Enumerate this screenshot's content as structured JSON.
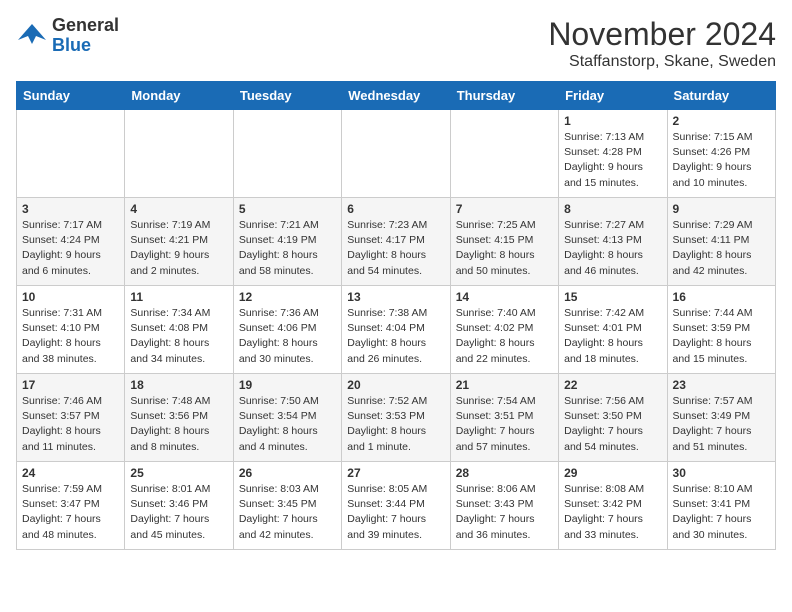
{
  "header": {
    "logo_line1": "General",
    "logo_line2": "Blue",
    "month": "November 2024",
    "location": "Staffanstorp, Skane, Sweden"
  },
  "days_of_week": [
    "Sunday",
    "Monday",
    "Tuesday",
    "Wednesday",
    "Thursday",
    "Friday",
    "Saturday"
  ],
  "weeks": [
    [
      {
        "day": "",
        "info": ""
      },
      {
        "day": "",
        "info": ""
      },
      {
        "day": "",
        "info": ""
      },
      {
        "day": "",
        "info": ""
      },
      {
        "day": "",
        "info": ""
      },
      {
        "day": "1",
        "info": "Sunrise: 7:13 AM\nSunset: 4:28 PM\nDaylight: 9 hours\nand 15 minutes."
      },
      {
        "day": "2",
        "info": "Sunrise: 7:15 AM\nSunset: 4:26 PM\nDaylight: 9 hours\nand 10 minutes."
      }
    ],
    [
      {
        "day": "3",
        "info": "Sunrise: 7:17 AM\nSunset: 4:24 PM\nDaylight: 9 hours\nand 6 minutes."
      },
      {
        "day": "4",
        "info": "Sunrise: 7:19 AM\nSunset: 4:21 PM\nDaylight: 9 hours\nand 2 minutes."
      },
      {
        "day": "5",
        "info": "Sunrise: 7:21 AM\nSunset: 4:19 PM\nDaylight: 8 hours\nand 58 minutes."
      },
      {
        "day": "6",
        "info": "Sunrise: 7:23 AM\nSunset: 4:17 PM\nDaylight: 8 hours\nand 54 minutes."
      },
      {
        "day": "7",
        "info": "Sunrise: 7:25 AM\nSunset: 4:15 PM\nDaylight: 8 hours\nand 50 minutes."
      },
      {
        "day": "8",
        "info": "Sunrise: 7:27 AM\nSunset: 4:13 PM\nDaylight: 8 hours\nand 46 minutes."
      },
      {
        "day": "9",
        "info": "Sunrise: 7:29 AM\nSunset: 4:11 PM\nDaylight: 8 hours\nand 42 minutes."
      }
    ],
    [
      {
        "day": "10",
        "info": "Sunrise: 7:31 AM\nSunset: 4:10 PM\nDaylight: 8 hours\nand 38 minutes."
      },
      {
        "day": "11",
        "info": "Sunrise: 7:34 AM\nSunset: 4:08 PM\nDaylight: 8 hours\nand 34 minutes."
      },
      {
        "day": "12",
        "info": "Sunrise: 7:36 AM\nSunset: 4:06 PM\nDaylight: 8 hours\nand 30 minutes."
      },
      {
        "day": "13",
        "info": "Sunrise: 7:38 AM\nSunset: 4:04 PM\nDaylight: 8 hours\nand 26 minutes."
      },
      {
        "day": "14",
        "info": "Sunrise: 7:40 AM\nSunset: 4:02 PM\nDaylight: 8 hours\nand 22 minutes."
      },
      {
        "day": "15",
        "info": "Sunrise: 7:42 AM\nSunset: 4:01 PM\nDaylight: 8 hours\nand 18 minutes."
      },
      {
        "day": "16",
        "info": "Sunrise: 7:44 AM\nSunset: 3:59 PM\nDaylight: 8 hours\nand 15 minutes."
      }
    ],
    [
      {
        "day": "17",
        "info": "Sunrise: 7:46 AM\nSunset: 3:57 PM\nDaylight: 8 hours\nand 11 minutes."
      },
      {
        "day": "18",
        "info": "Sunrise: 7:48 AM\nSunset: 3:56 PM\nDaylight: 8 hours\nand 8 minutes."
      },
      {
        "day": "19",
        "info": "Sunrise: 7:50 AM\nSunset: 3:54 PM\nDaylight: 8 hours\nand 4 minutes."
      },
      {
        "day": "20",
        "info": "Sunrise: 7:52 AM\nSunset: 3:53 PM\nDaylight: 8 hours\nand 1 minute."
      },
      {
        "day": "21",
        "info": "Sunrise: 7:54 AM\nSunset: 3:51 PM\nDaylight: 7 hours\nand 57 minutes."
      },
      {
        "day": "22",
        "info": "Sunrise: 7:56 AM\nSunset: 3:50 PM\nDaylight: 7 hours\nand 54 minutes."
      },
      {
        "day": "23",
        "info": "Sunrise: 7:57 AM\nSunset: 3:49 PM\nDaylight: 7 hours\nand 51 minutes."
      }
    ],
    [
      {
        "day": "24",
        "info": "Sunrise: 7:59 AM\nSunset: 3:47 PM\nDaylight: 7 hours\nand 48 minutes."
      },
      {
        "day": "25",
        "info": "Sunrise: 8:01 AM\nSunset: 3:46 PM\nDaylight: 7 hours\nand 45 minutes."
      },
      {
        "day": "26",
        "info": "Sunrise: 8:03 AM\nSunset: 3:45 PM\nDaylight: 7 hours\nand 42 minutes."
      },
      {
        "day": "27",
        "info": "Sunrise: 8:05 AM\nSunset: 3:44 PM\nDaylight: 7 hours\nand 39 minutes."
      },
      {
        "day": "28",
        "info": "Sunrise: 8:06 AM\nSunset: 3:43 PM\nDaylight: 7 hours\nand 36 minutes."
      },
      {
        "day": "29",
        "info": "Sunrise: 8:08 AM\nSunset: 3:42 PM\nDaylight: 7 hours\nand 33 minutes."
      },
      {
        "day": "30",
        "info": "Sunrise: 8:10 AM\nSunset: 3:41 PM\nDaylight: 7 hours\nand 30 minutes."
      }
    ]
  ]
}
